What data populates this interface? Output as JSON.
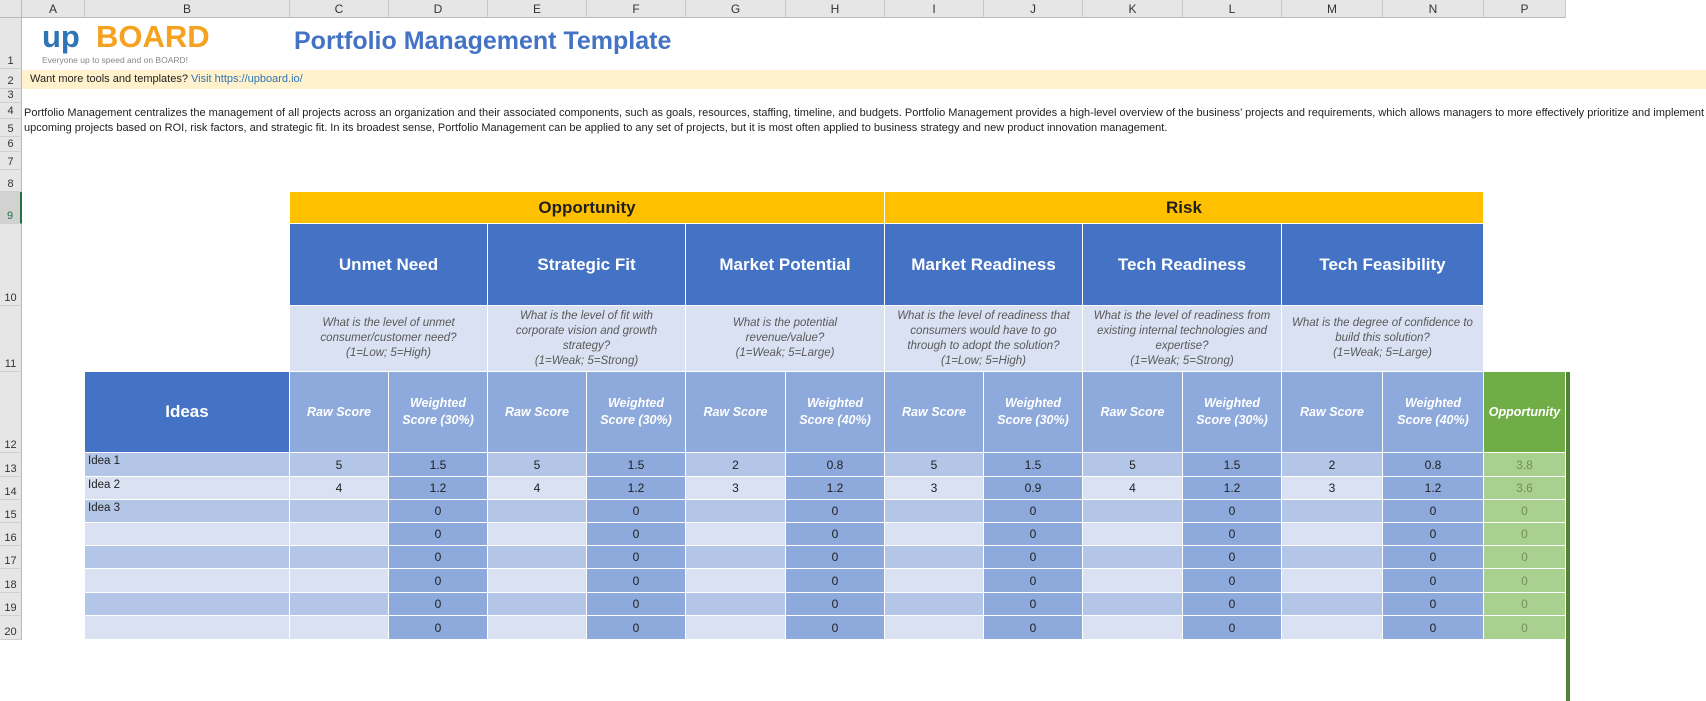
{
  "columns": [
    "A",
    "B",
    "C",
    "D",
    "E",
    "F",
    "G",
    "H",
    "I",
    "J",
    "K",
    "L",
    "M",
    "N",
    "P"
  ],
  "rows": [
    "1",
    "2",
    "3",
    "4",
    "5",
    "6",
    "7",
    "8",
    "9",
    "10",
    "11",
    "12",
    "13",
    "14",
    "15",
    "16",
    "17",
    "18",
    "19",
    "20"
  ],
  "logo": {
    "brand_prefix": "up",
    "brand_suffix": "BOARD",
    "tagline": "Everyone up to speed and on BOARD!"
  },
  "title": "Portfolio Management Template",
  "promo": {
    "text": "Want more tools and templates? ",
    "link": "Visit https://upboard.io/"
  },
  "description": "Portfolio Management centralizes the management of all projects across an organization and their associated components, such as goals, resources, staffing, timeline, and budgets. Portfolio Management provides a high-level overview of the business’ projects and requirements, which allows managers to more effectively prioritize and implement upcoming projects based on ROI, risk factors, and strategic fit. In its broadest sense, Portfolio Management can be applied to any set of projects, but it is most often applied to business strategy and new product innovation management.",
  "bands": {
    "opportunity": "Opportunity",
    "risk": "Risk"
  },
  "categories": [
    {
      "name": "Unmet Need",
      "question": "What is the level of unmet consumer/customer need?",
      "scale": "(1=Low; 5=High)",
      "raw": "Raw Score",
      "weighted": "Weighted Score (30%)"
    },
    {
      "name": "Strategic Fit",
      "question": "What is the level of fit with corporate vision and growth strategy?",
      "scale": "(1=Weak; 5=Strong)",
      "raw": "Raw Score",
      "weighted": "Weighted Score (30%)"
    },
    {
      "name": "Market Potential",
      "question": "What is the potential revenue/value?",
      "scale": "(1=Weak; 5=Large)",
      "raw": "Raw Score",
      "weighted": "Weighted Score (40%)"
    },
    {
      "name": "Market Readiness",
      "question": "What is the level of readiness that consumers would have to go through to adopt the solution?",
      "scale": "(1=Low; 5=High)",
      "raw": "Raw Score",
      "weighted": "Weighted Score (30%)"
    },
    {
      "name": "Tech Readiness",
      "question": "What is the level of readiness from existing internal technologies and expertise?",
      "scale": "(1=Weak; 5=Strong)",
      "raw": "Raw Score",
      "weighted": "Weighted Score (30%)"
    },
    {
      "name": "Tech Feasibility",
      "question": "What is the degree of confidence to build this solution?",
      "scale": "(1=Weak; 5=Large)",
      "raw": "Raw Score",
      "weighted": "Weighted Score (40%)"
    }
  ],
  "ideas_header": "Ideas",
  "opportunity_header": "Opportunity",
  "table_rows": [
    {
      "idea": "Idea 1",
      "raw": [
        "5",
        "5",
        "2",
        "5",
        "5",
        "2"
      ],
      "weighted": [
        "1.5",
        "1.5",
        "0.8",
        "1.5",
        "1.5",
        "0.8"
      ],
      "opportunity": "3.8"
    },
    {
      "idea": "Idea 2",
      "raw": [
        "4",
        "4",
        "3",
        "3",
        "4",
        "3"
      ],
      "weighted": [
        "1.2",
        "1.2",
        "1.2",
        "0.9",
        "1.2",
        "1.2"
      ],
      "opportunity": "3.6"
    },
    {
      "idea": "Idea 3",
      "raw": [
        "",
        "",
        "",
        "",
        "",
        ""
      ],
      "weighted": [
        "0",
        "0",
        "0",
        "0",
        "0",
        "0"
      ],
      "opportunity": "0"
    },
    {
      "idea": "",
      "raw": [
        "",
        "",
        "",
        "",
        "",
        ""
      ],
      "weighted": [
        "0",
        "0",
        "0",
        "0",
        "0",
        "0"
      ],
      "opportunity": "0"
    },
    {
      "idea": "",
      "raw": [
        "",
        "",
        "",
        "",
        "",
        ""
      ],
      "weighted": [
        "0",
        "0",
        "0",
        "0",
        "0",
        "0"
      ],
      "opportunity": "0"
    },
    {
      "idea": "",
      "raw": [
        "",
        "",
        "",
        "",
        "",
        ""
      ],
      "weighted": [
        "0",
        "0",
        "0",
        "0",
        "0",
        "0"
      ],
      "opportunity": "0"
    },
    {
      "idea": "",
      "raw": [
        "",
        "",
        "",
        "",
        "",
        ""
      ],
      "weighted": [
        "0",
        "0",
        "0",
        "0",
        "0",
        "0"
      ],
      "opportunity": "0"
    },
    {
      "idea": "",
      "raw": [
        "",
        "",
        "",
        "",
        "",
        ""
      ],
      "weighted": [
        "0",
        "0",
        "0",
        "0",
        "0",
        "0"
      ],
      "opportunity": "0"
    }
  ]
}
